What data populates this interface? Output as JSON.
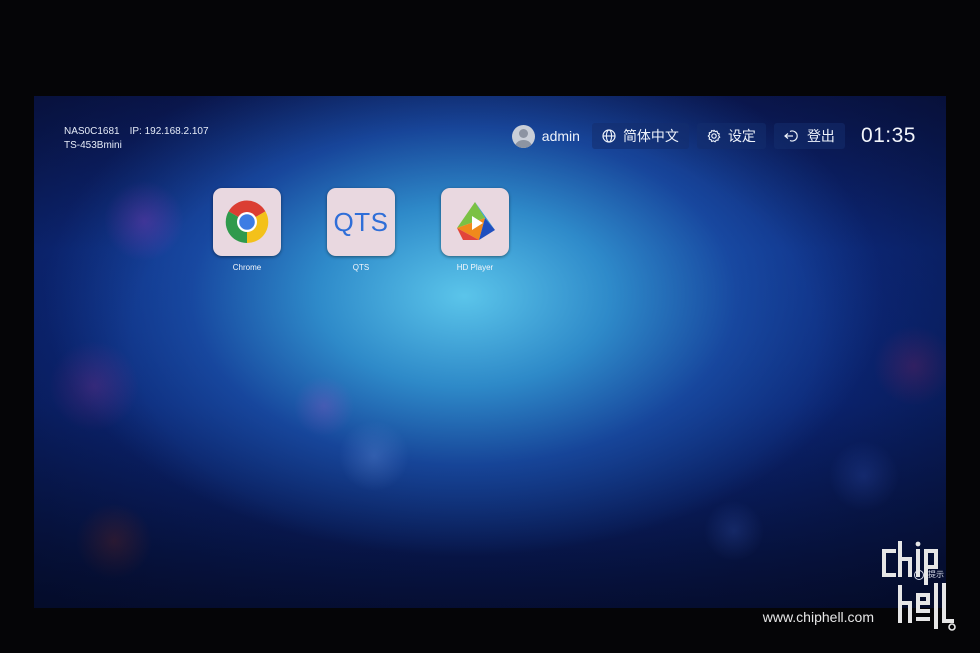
{
  "system": {
    "hostname": "NAS0C1681",
    "ip": "IP: 192.168.2.107",
    "model": "TS-453Bmini"
  },
  "topbar": {
    "username": "admin",
    "language_label": "简体中文",
    "settings_label": "设定",
    "logout_label": "登出",
    "clock": "01:35"
  },
  "apps": [
    {
      "label": "Chrome",
      "icon": "chrome-icon"
    },
    {
      "label": "QTS",
      "icon": "qts-icon",
      "icon_text": "QTS"
    },
    {
      "label": "HD Player",
      "icon": "hd-player-icon"
    }
  ],
  "hint": {
    "label": "提示"
  },
  "watermark": {
    "site": "www.chiphell.com"
  },
  "colors": {
    "accent": "#2f6ed8",
    "tile_bg": "#e9d8e0",
    "text": "#eef3fb"
  }
}
